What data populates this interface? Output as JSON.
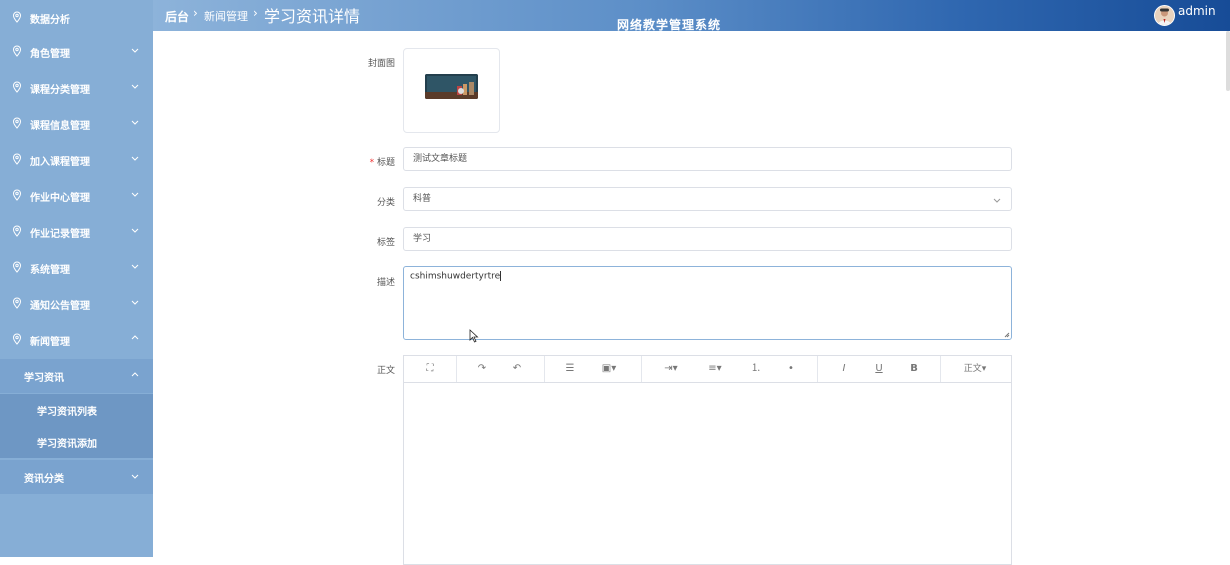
{
  "header": {
    "breadcrumb_root": "后台",
    "breadcrumb_mid": "新闻管理",
    "page_title": "学习资讯详情",
    "system_title": "网络教学管理系统",
    "username": "admin"
  },
  "sidebar": {
    "items": [
      {
        "label": "数据分析"
      },
      {
        "label": "角色管理"
      },
      {
        "label": "课程分类管理"
      },
      {
        "label": "课程信息管理"
      },
      {
        "label": "加入课程管理"
      },
      {
        "label": "作业中心管理"
      },
      {
        "label": "作业记录管理"
      },
      {
        "label": "系统管理"
      },
      {
        "label": "通知公告管理"
      },
      {
        "label": "新闻管理"
      }
    ],
    "sub_group": "学习资讯",
    "sub_leaves": [
      {
        "label": "学习资讯列表"
      },
      {
        "label": "学习资讯添加"
      }
    ],
    "sub_group2": "资讯分类"
  },
  "form": {
    "cover_label": "封面图",
    "title_label": "标题",
    "title_value": "测试文章标题",
    "category_label": "分类",
    "category_value": "科普",
    "tags_label": "标签",
    "tags_value": "学习",
    "desc_label": "描述",
    "desc_value": "cshimshuwdertyrtre",
    "body_label": "正文",
    "paragraph_style": "正文"
  },
  "colors": {
    "sidebar_bg": "#86aed6",
    "header_gradient_end": "#174c97",
    "active_leaf_bg": "#6e97c4"
  }
}
